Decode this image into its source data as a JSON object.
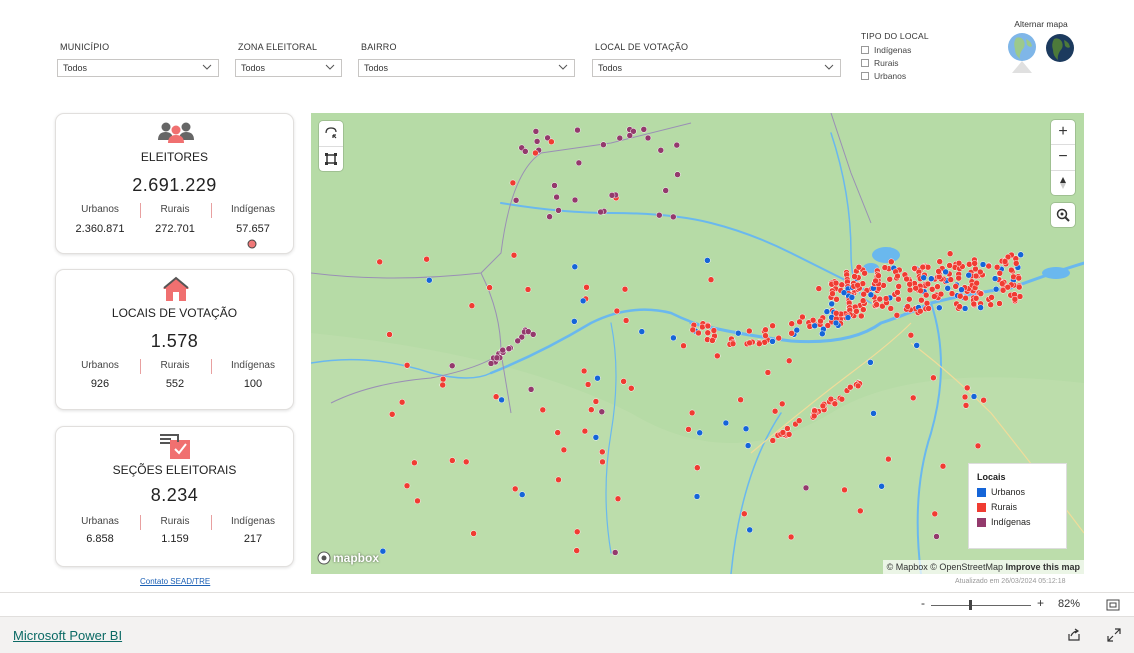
{
  "filters": {
    "municipio": {
      "label": "MUNICÍPIO",
      "value": "Todos"
    },
    "zona": {
      "label": "ZONA ELEITORAL",
      "value": "Todos"
    },
    "bairro": {
      "label": "BAIRRO",
      "value": "Todos"
    },
    "local": {
      "label": "LOCAL DE VOTAÇÃO",
      "value": "Todos"
    },
    "tipo": {
      "label": "TIPO DO LOCAL",
      "options": [
        "Indígenas",
        "Rurais",
        "Urbanos"
      ]
    }
  },
  "alternar_mapa": "Alternar mapa",
  "cards": {
    "eleitores": {
      "title": "ELEITORES",
      "value": "2.691.229",
      "labels": [
        "Urbanos",
        "Rurais",
        "Indígenas"
      ],
      "values": [
        "2.360.871",
        "272.701",
        "57.657"
      ]
    },
    "locais": {
      "title": "LOCAIS DE VOTAÇÃO",
      "value": "1.578",
      "labels": [
        "Urbanos",
        "Rurais",
        "Indígenas"
      ],
      "values": [
        "926",
        "552",
        "100"
      ]
    },
    "secoes": {
      "title": "SEÇÕES ELEITORAIS",
      "value": "8.234",
      "labels": [
        "Urbanas",
        "Rurais",
        "Indígenas"
      ],
      "values": [
        "6.858",
        "1.159",
        "217"
      ]
    }
  },
  "contato": "Contato SEAD/TRE",
  "map": {
    "legend_title": "Locais",
    "legend": [
      {
        "name": "Urbanos",
        "color": "#1565d8"
      },
      {
        "name": "Rurais",
        "color": "#f03c32"
      },
      {
        "name": "Indígenas",
        "color": "#933a6c"
      }
    ],
    "attribution_mapbox": "© Mapbox",
    "attribution_osm": "© OpenStreetMap",
    "improve": "Improve this map",
    "logo": "mapbox"
  },
  "atualizado": "Atualizado em 26/03/2024 05:12:18",
  "zoom": {
    "minus": "-",
    "plus": "+",
    "level": "82%"
  },
  "powerbi_link": "Microsoft Power BI"
}
